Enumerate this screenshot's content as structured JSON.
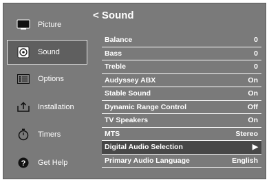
{
  "sidebar": {
    "items": [
      {
        "label": "Picture",
        "icon": "tv-icon",
        "active": false
      },
      {
        "label": "Sound",
        "icon": "speaker-icon",
        "active": true
      },
      {
        "label": "Options",
        "icon": "options-list-icon",
        "active": false
      },
      {
        "label": "Installation",
        "icon": "installation-icon",
        "active": false
      },
      {
        "label": "Timers",
        "icon": "timer-icon",
        "active": false
      },
      {
        "label": "Get Help",
        "icon": "help-icon",
        "active": false
      }
    ]
  },
  "main": {
    "title": "< Sound",
    "rows": [
      {
        "label": "Balance",
        "value": "0"
      },
      {
        "label": "Bass",
        "value": "0"
      },
      {
        "label": "Treble",
        "value": "0"
      },
      {
        "label": "Audyssey ABX",
        "value": "On"
      },
      {
        "label": "Stable Sound",
        "value": "On"
      },
      {
        "label": "Dynamic Range Control",
        "value": "Off"
      },
      {
        "label": "TV Speakers",
        "value": "On"
      },
      {
        "label": "MTS",
        "value": "Stereo"
      },
      {
        "label": "Digital Audio Selection",
        "value": "▶",
        "selected": true
      },
      {
        "label": "Primary Audio Language",
        "value": "English"
      }
    ]
  },
  "colors": {
    "panel": "#7a7a7a",
    "selected_row": "#474747",
    "text": "#ffffff"
  }
}
